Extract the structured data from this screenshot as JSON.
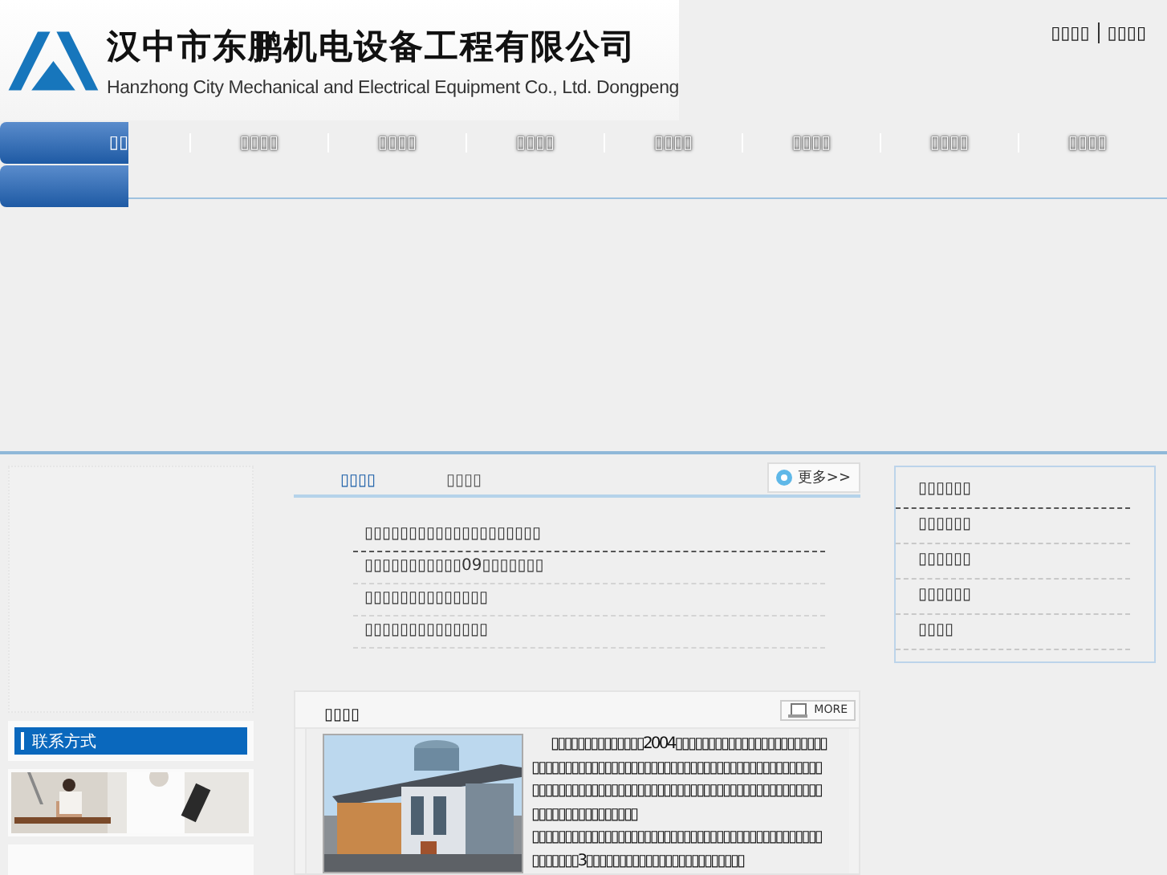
{
  "header": {
    "company_name": "汉中市东鹏机电设备工程有限公司",
    "company_name_en": "Hanzhong City Mechanical and Electrical Equipment Co., Ltd. Dongpeng",
    "top_links": [
      "▯▯▯▯",
      "▯▯▯▯"
    ]
  },
  "nav": [
    {
      "label": "▯▯",
      "selected": true
    },
    {
      "label": "▯▯▯▯",
      "selected": false
    },
    {
      "label": "▯▯▯▯",
      "selected": false
    },
    {
      "label": "▯▯▯▯",
      "selected": false
    },
    {
      "label": "▯▯▯▯",
      "selected": false
    },
    {
      "label": "▯▯▯▯",
      "selected": false
    },
    {
      "label": "▯▯▯▯",
      "selected": false
    },
    {
      "label": "▯▯▯▯",
      "selected": false
    }
  ],
  "sidebar": {
    "contact_title": "联系方式"
  },
  "news": {
    "tabs": [
      {
        "label": "▯▯▯▯",
        "selected": true
      },
      {
        "label": "▯▯▯▯",
        "selected": false
      }
    ],
    "more": "更多>>",
    "items": [
      "▯▯▯▯▯▯▯▯▯▯▯▯▯▯▯▯▯▯▯▯",
      "▯▯▯▯▯▯▯▯▯▯▯09▯▯▯▯▯▯▯",
      "▯▯▯▯▯▯▯▯▯▯▯▯▯▯",
      "▯▯▯▯▯▯▯▯▯▯▯▯▯▯"
    ]
  },
  "intro": {
    "title": "▯▯▯▯",
    "more": "MORE",
    "paragraphs": [
      "▯▯▯▯▯▯▯▯▯▯▯▯▯▯2004▯▯▯▯▯▯▯▯▯▯▯▯▯▯▯▯▯▯▯▯▯▯▯▯▯▯▯▯▯▯▯▯▯▯▯▯▯▯▯▯▯▯▯▯▯▯▯▯▯▯▯▯▯▯▯▯▯▯▯▯▯▯▯▯▯▯▯▯▯▯▯▯▯▯▯▯▯▯▯▯▯▯▯▯▯▯▯▯▯▯▯▯▯▯▯▯▯▯▯▯▯▯▯▯▯▯▯▯▯▯▯▯▯▯▯▯▯▯▯▯▯▯▯▯▯▯▯",
      "▯▯▯▯▯▯▯▯▯▯▯▯▯▯▯▯▯▯▯▯▯▯▯▯▯▯▯▯▯▯▯▯▯▯▯▯▯▯▯▯▯▯▯▯▯▯▯▯▯▯▯3▯▯▯▯▯▯▯▯▯▯▯▯▯▯▯▯▯▯▯▯▯▯▯▯"
    ]
  },
  "right_menu": [
    "▯▯▯▯▯▯",
    "▯▯▯▯▯▯",
    "▯▯▯▯▯▯",
    "▯▯▯▯▯▯",
    "▯▯▯▯"
  ]
}
